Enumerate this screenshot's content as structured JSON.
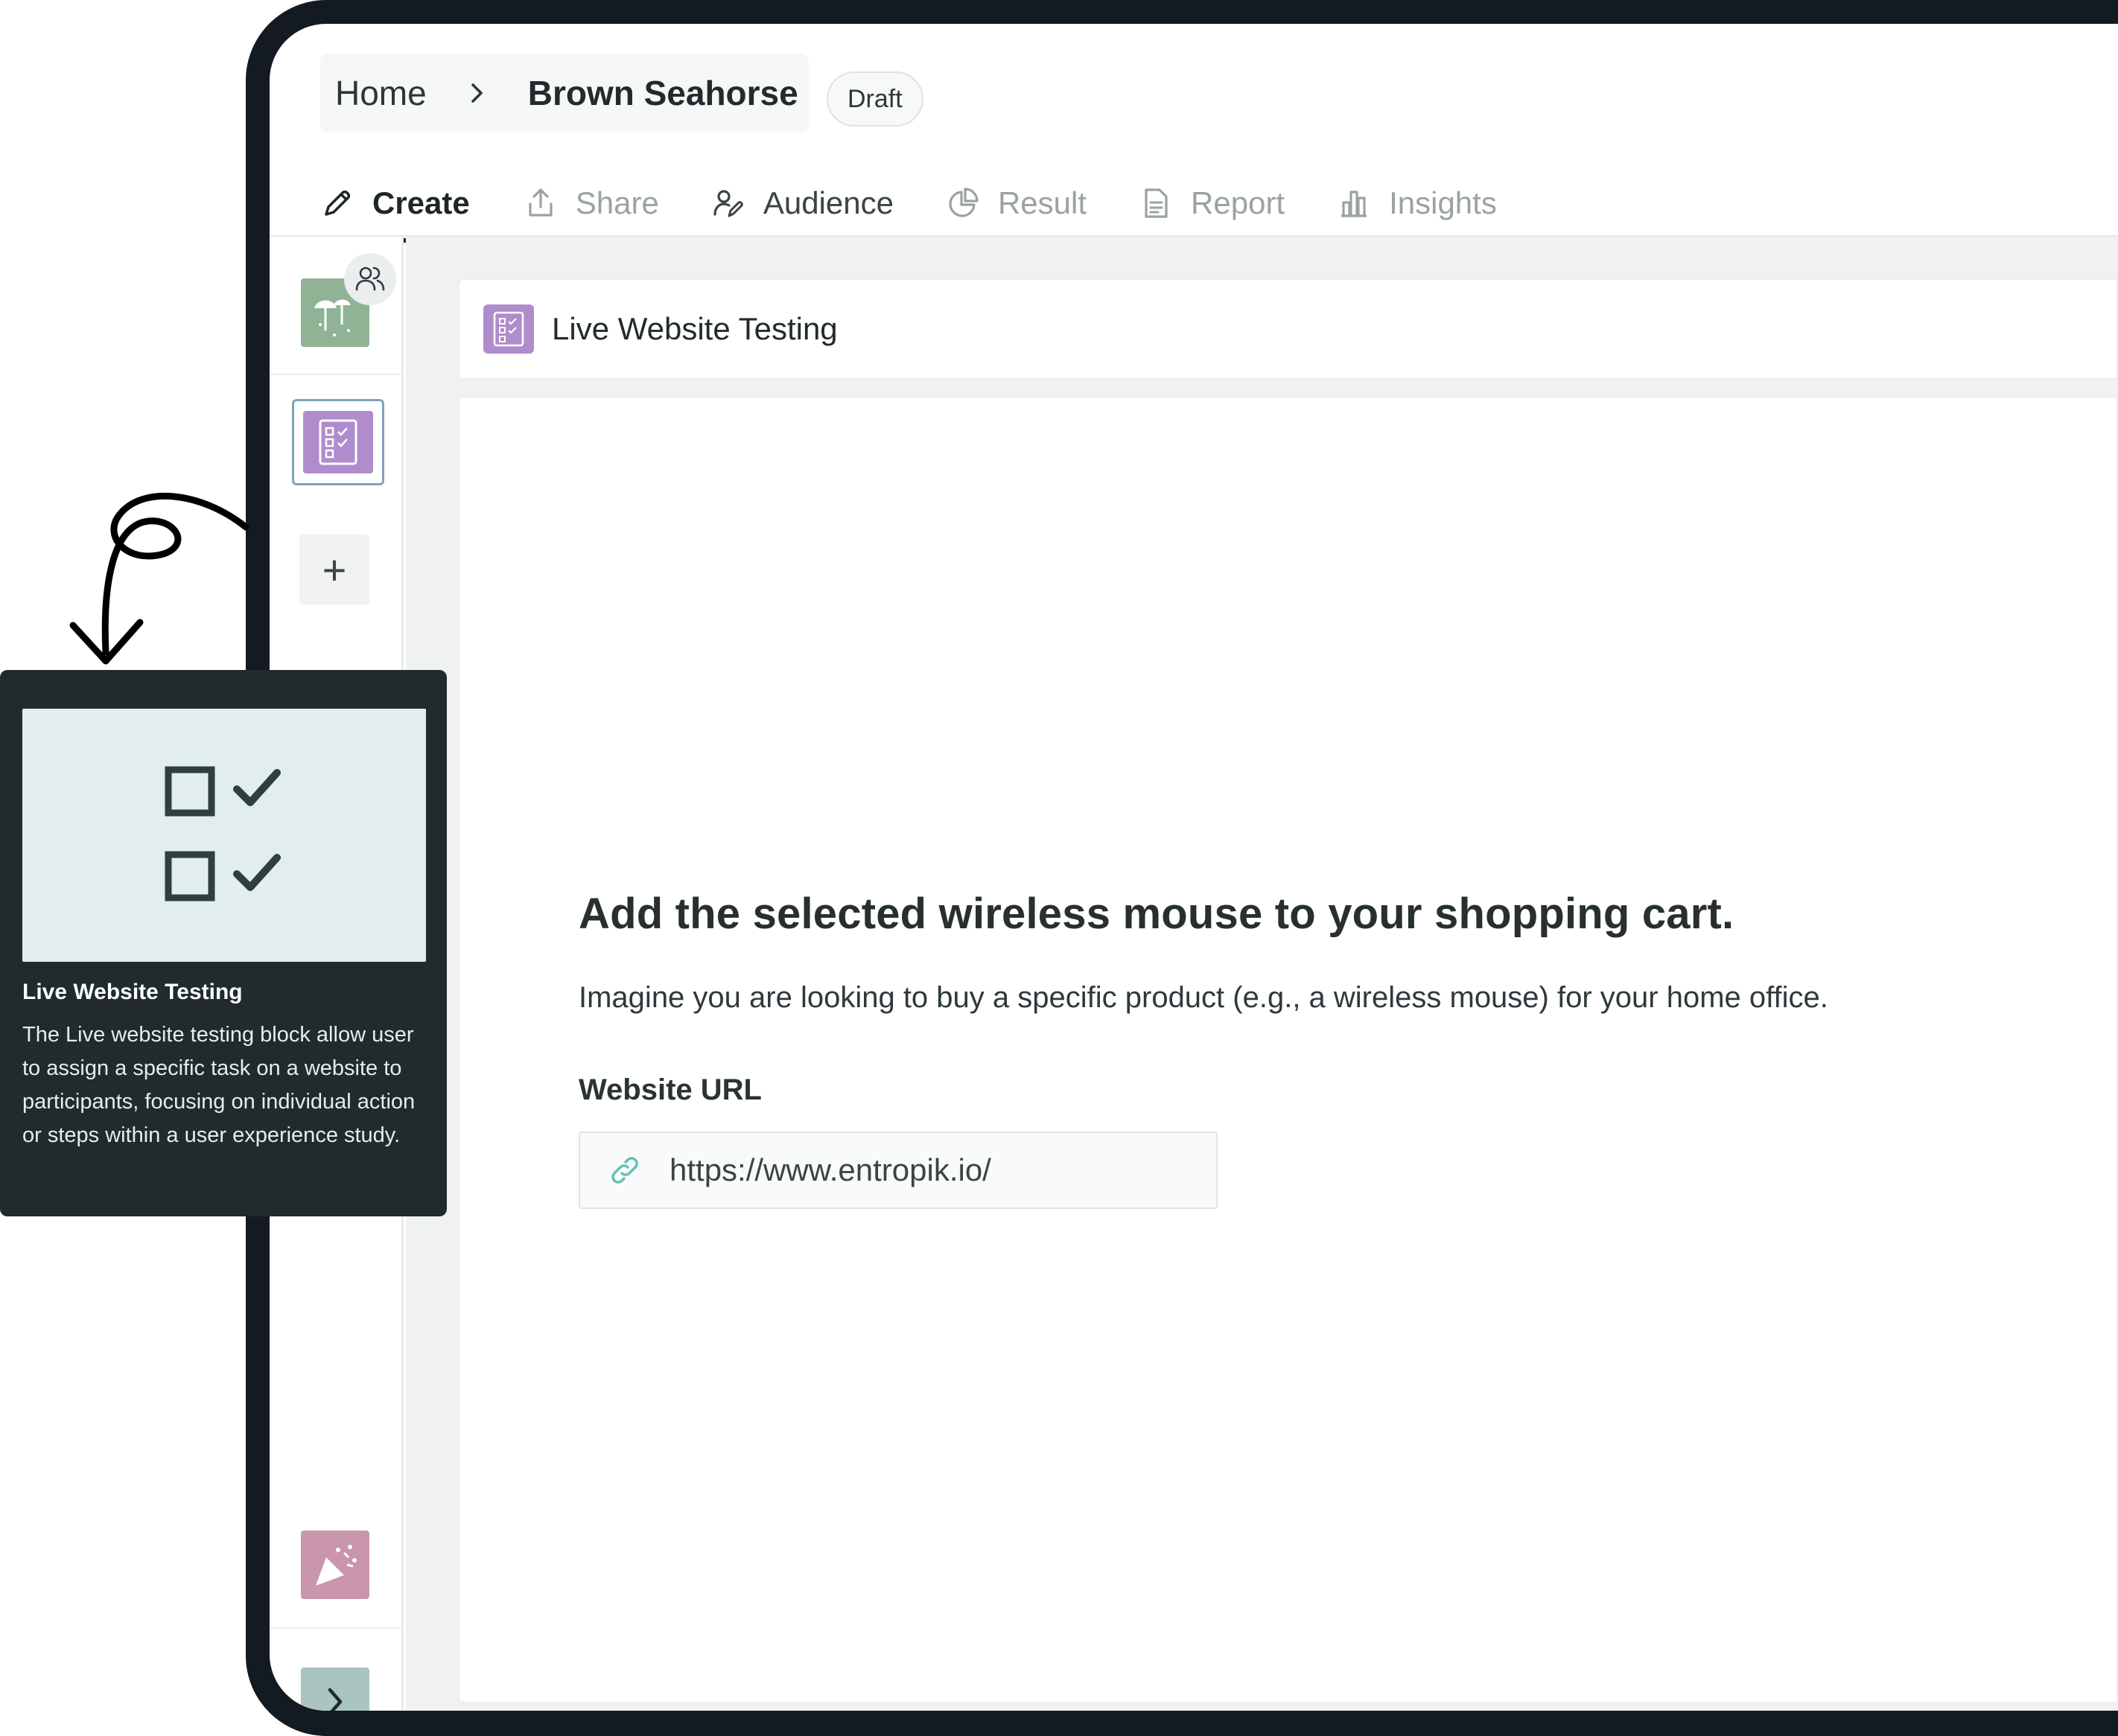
{
  "breadcrumb": {
    "home": "Home",
    "current": "Brown Seahorse",
    "status": "Draft"
  },
  "tabs": [
    {
      "label": "Create",
      "icon": "pencil-icon",
      "state": "active"
    },
    {
      "label": "Share",
      "icon": "share-icon",
      "state": "disabled"
    },
    {
      "label": "Audience",
      "icon": "audience-icon",
      "state": "enabled"
    },
    {
      "label": "Result",
      "icon": "pie-chart-icon",
      "state": "disabled"
    },
    {
      "label": "Report",
      "icon": "document-icon",
      "state": "disabled"
    },
    {
      "label": "Insights",
      "icon": "bar-chart-icon",
      "state": "disabled"
    }
  ],
  "sidebar": {
    "add_label": "+"
  },
  "block": {
    "title": "Live Website Testing",
    "task_title": "Add the selected wireless mouse to your shopping cart.",
    "task_description": "Imagine you are looking to buy a specific product (e.g., a wireless mouse) for your home office.",
    "url_label": "Website URL",
    "url_value": "https://www.entropik.io/"
  },
  "tooltip": {
    "title": "Live Website Testing",
    "description": "The Live website testing block allow user to assign a specific task on a website to participants, focusing on individual action or steps within a user experience study."
  },
  "colors": {
    "frame": "#141a21",
    "block_accent": "#b08ccc",
    "welcome_block": "#8fb394",
    "thankyou_block": "#c996ad",
    "tooltip_bg": "#212b2c",
    "link_icon": "#5fc3b4"
  }
}
